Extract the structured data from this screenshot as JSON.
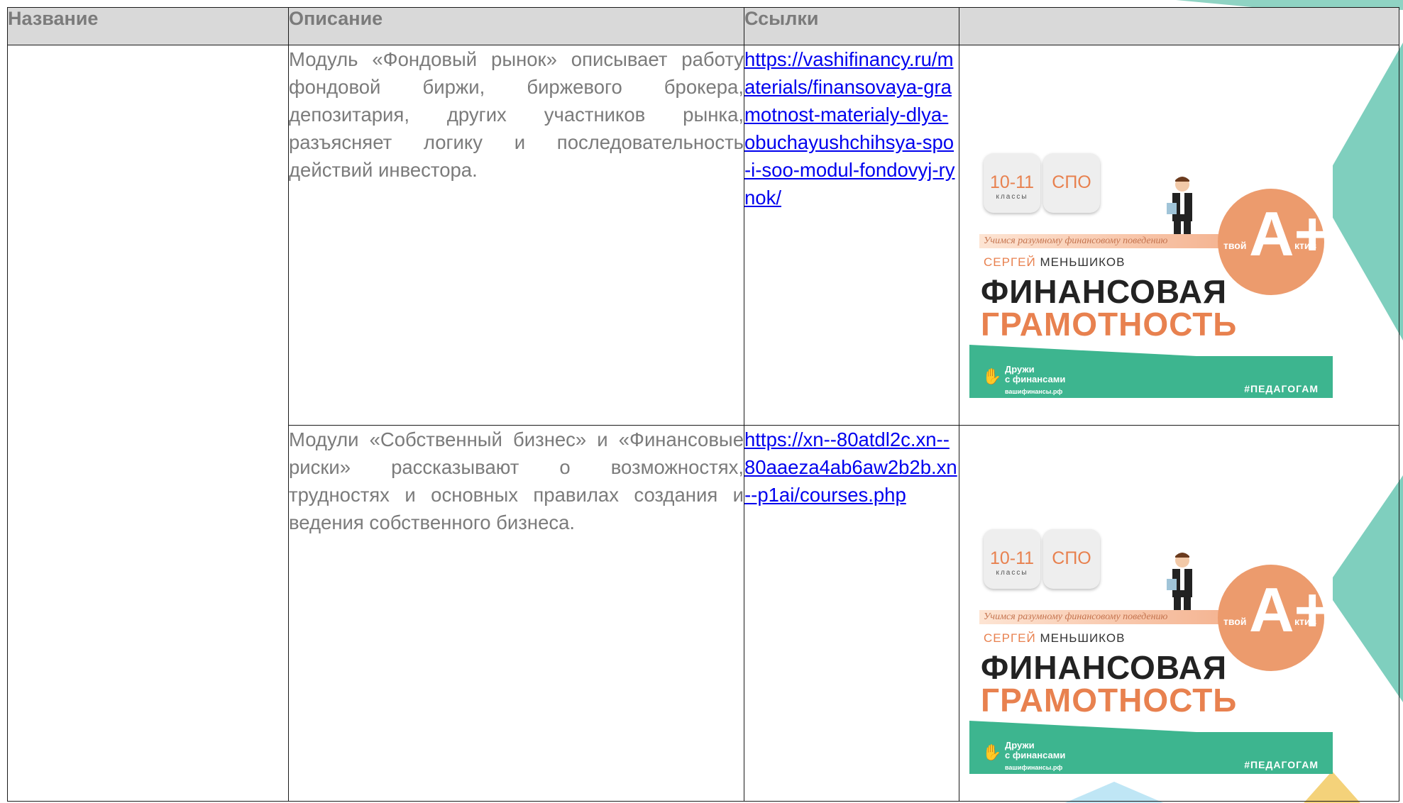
{
  "table": {
    "headers": [
      "Название",
      "Описание",
      "Ссылки",
      ""
    ],
    "rows": [
      {
        "name": "",
        "description": "Модуль «Фондовый рынок» описывает работу фондовой биржи, биржевого брокера, депозитария, других участников рынка, разъясняет логику и последовательность действий инвестора.",
        "link": "https://vashifinancy.ru/materials/finansovaya-gramotnost-materialy-dlya-obuchayushchihsya-spo-i-soo-modul-fondovyj-rynok/"
      },
      {
        "name": "",
        "description": "Модули «Собственный бизнес» и «Финансовые риски» рассказывают о возможностях, трудностях и основных правилах создания и ведения собственного бизнеса.",
        "link": "https://xn--80atdl2c.xn--80aaeza4ab6aw2b2b.xn--p1ai/courses.php"
      }
    ]
  },
  "cover": {
    "badge_grades": "10-11",
    "badge_grades_sub": "классы",
    "badge_spo": "СПО",
    "slogan": "Учимся разумному финансовому поведению",
    "circle_left": "твой",
    "circle_main": "A+",
    "circle_right": "ктив",
    "author_first": "СЕРГЕЙ",
    "author_last": "МЕНЬШИКОВ",
    "title_line1": "ФИНАНСОВАЯ",
    "title_line2": "ГРАМОТНОСТЬ",
    "friends_line1": "Дружи",
    "friends_line2": "с финансами",
    "friends_site": "вашифинансы.рф",
    "hashtag": "#ПЕДАГОГАМ"
  },
  "colors": {
    "header_bg": "#d9d9d9",
    "header_text": "#7b7b7b",
    "body_text": "#7b7b7b",
    "link": "#0000ee",
    "accent_orange": "#e8814f",
    "accent_green": "#3db58f"
  }
}
